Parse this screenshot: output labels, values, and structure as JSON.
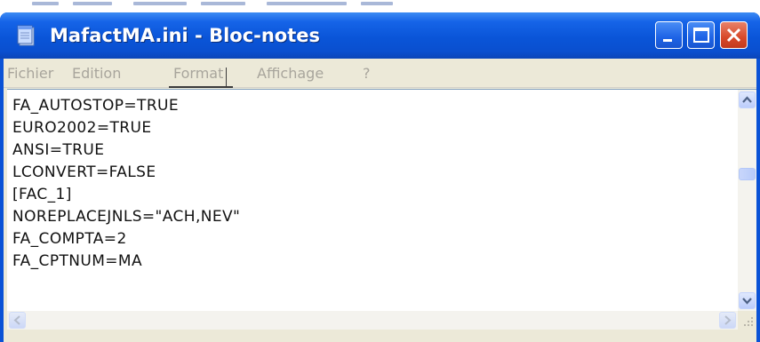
{
  "window": {
    "title": "MafactMA.ini - Bloc-notes",
    "icon": "notepad-icon",
    "controls": {
      "minimize": "minimize-icon",
      "maximize": "maximize-icon",
      "close": "close-icon"
    }
  },
  "menu": {
    "items": [
      {
        "label": "Fichier"
      },
      {
        "label": "Edition"
      },
      {
        "label": "Format"
      },
      {
        "label": "Affichage"
      },
      {
        "label": "?"
      }
    ]
  },
  "editor": {
    "lines": [
      "FA_AUTOSTOP=TRUE",
      "EURO2002=TRUE",
      "ANSI=TRUE",
      "LCONVERT=FALSE",
      "[FAC_1]",
      "NOREPLACEJNLS=\"ACH,NEV\"",
      "FA_COMPTA=2",
      "FA_CPTNUM=MA"
    ]
  },
  "colors": {
    "titlebar": "#0a55d8",
    "close_button": "#d7492a",
    "menu_text_disabled": "#a8a59c",
    "scrollbar": "#bccdfb"
  }
}
